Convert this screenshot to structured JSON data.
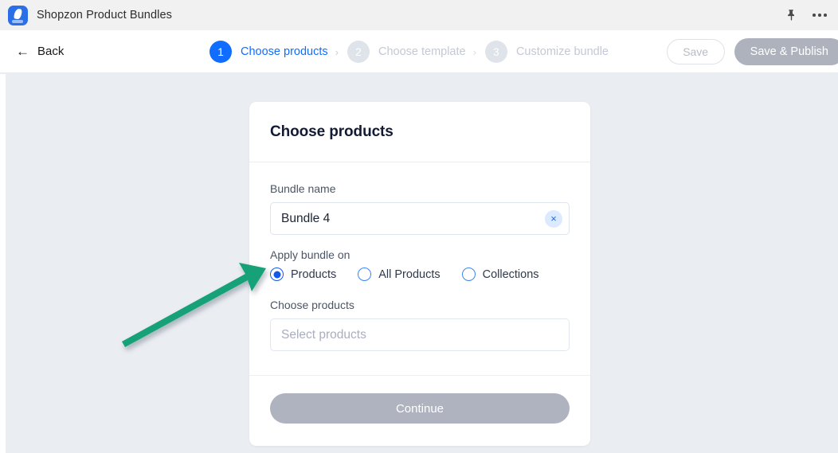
{
  "titlebar": {
    "app_name": "Shopzon Product Bundles",
    "app_icon": "shopzon-app-icon",
    "pin_icon": "pin-icon",
    "more_icon": "more-options-icon"
  },
  "navbar": {
    "back_label": "Back",
    "back_icon": "arrow-left-icon",
    "steps": [
      {
        "number": "1",
        "label": "Choose products",
        "state": "active"
      },
      {
        "number": "2",
        "label": "Choose template",
        "state": "inactive"
      },
      {
        "number": "3",
        "label": "Customize bundle",
        "state": "inactive"
      }
    ],
    "separator": "›",
    "save_label": "Save",
    "save_publish_label": "Save & Publish"
  },
  "card": {
    "title": "Choose products",
    "bundle_name_label": "Bundle name",
    "bundle_name_value": "Bundle 4",
    "bundle_name_placeholder": "Bundle name",
    "clear_icon": "×",
    "apply_label": "Apply bundle on",
    "radio_options": [
      {
        "label": "Products",
        "selected": true
      },
      {
        "label": "All Products",
        "selected": false
      },
      {
        "label": "Collections",
        "selected": false
      }
    ],
    "choose_products_label": "Choose products",
    "choose_products_value": "",
    "choose_products_placeholder": "Select products",
    "continue_label": "Continue"
  },
  "annotation": {
    "arrow_color": "#12a178",
    "arrow_target": "products-radio-option"
  },
  "colors": {
    "accent_blue": "#116dff",
    "radio_blue": "#1558e8",
    "disabled_grey": "#aeb3bf",
    "page_background": "#eaedf2",
    "title_navy": "#131a33"
  }
}
